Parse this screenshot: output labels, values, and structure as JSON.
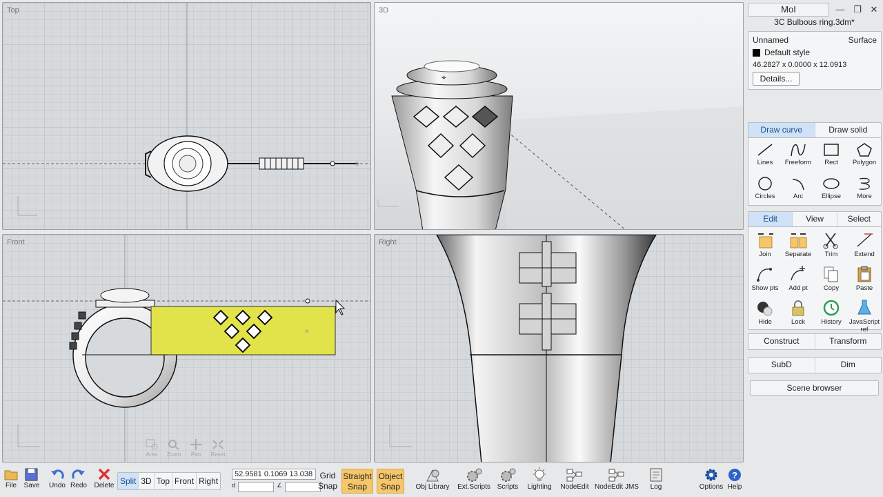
{
  "viewports": {
    "top": {
      "label": "Top"
    },
    "three_d": {
      "label": "3D"
    },
    "front": {
      "label": "Front"
    },
    "right": {
      "label": "Right"
    }
  },
  "nav_tools": [
    {
      "icon": "zoom-area-icon",
      "label": "Area"
    },
    {
      "icon": "zoom-icon",
      "label": "Zoom"
    },
    {
      "icon": "pan-icon",
      "label": "Pan"
    },
    {
      "icon": "reset-icon",
      "label": "Reset"
    }
  ],
  "app": {
    "name": "MoI",
    "file_title": "3C Bulbous ring.3dm*"
  },
  "properties": {
    "name": "Unnamed",
    "type": "Surface",
    "style": "Default style",
    "dimensions": "46.2827 x 0.0000 x 12.0913",
    "details_label": "Details..."
  },
  "draw_tabs": [
    "Draw curve",
    "Draw solid"
  ],
  "draw_tools": [
    {
      "icon": "lines-icon",
      "label": "Lines"
    },
    {
      "icon": "freeform-icon",
      "label": "Freeform"
    },
    {
      "icon": "rect-icon",
      "label": "Rect"
    },
    {
      "icon": "polygon-icon",
      "label": "Polygon"
    },
    {
      "icon": "circles-icon",
      "label": "Circles"
    },
    {
      "icon": "arc-icon",
      "label": "Arc"
    },
    {
      "icon": "ellipse-icon",
      "label": "Ellipse"
    },
    {
      "icon": "more-icon",
      "label": "More"
    }
  ],
  "edit_tabs": [
    "Edit",
    "View",
    "Select"
  ],
  "edit_tools": [
    {
      "icon": "join-icon",
      "label": "Join"
    },
    {
      "icon": "separate-icon",
      "label": "Separate"
    },
    {
      "icon": "trim-icon",
      "label": "Trim"
    },
    {
      "icon": "extend-icon",
      "label": "Extend"
    },
    {
      "icon": "show-pts-icon",
      "label": "Show pts"
    },
    {
      "icon": "add-pt-icon",
      "label": "Add pt"
    },
    {
      "icon": "copy-icon",
      "label": "Copy"
    },
    {
      "icon": "paste-icon",
      "label": "Paste"
    },
    {
      "icon": "hide-icon",
      "label": "Hide"
    },
    {
      "icon": "lock-icon",
      "label": "Lock"
    },
    {
      "icon": "history-icon",
      "label": "History"
    },
    {
      "icon": "javascript-ref-icon",
      "label": "JavaScript ref"
    }
  ],
  "construct_row": [
    "Construct",
    "Transform"
  ],
  "subd_row": [
    "SubD",
    "Dim"
  ],
  "scene_browser_label": "Scene browser",
  "bottom": {
    "file": "File",
    "save": "Save",
    "undo": "Undo",
    "redo": "Redo",
    "delete": "Delete",
    "views": [
      "Split",
      "3D",
      "Top",
      "Front",
      "Right"
    ],
    "active_view": "Split",
    "coords": "52.9581  0.1069  13.038",
    "distance_prefix": "d",
    "grid_snap": [
      "Grid",
      "Snap"
    ],
    "straight_snap": [
      "Straight",
      "Snap"
    ],
    "object_snap": [
      "Object",
      "Snap"
    ],
    "tools": [
      {
        "icon": "obj-library-icon",
        "label": "Obj Library"
      },
      {
        "icon": "ext-scripts-icon",
        "label": "Ext.Scripts"
      },
      {
        "icon": "scripts-icon",
        "label": "Scripts"
      },
      {
        "icon": "lighting-icon",
        "label": "Lighting"
      },
      {
        "icon": "nodeedit-icon",
        "label": "NodeEdit"
      },
      {
        "icon": "nodeedit-jms-icon",
        "label": "NodeEdit JMS"
      },
      {
        "icon": "log-icon",
        "label": "Log"
      }
    ],
    "options": "Options",
    "help": "Help"
  },
  "colors": {
    "selection": "#e2e24a",
    "active_tab": "#cfe2f7",
    "snap_on": "#f5c76a"
  }
}
